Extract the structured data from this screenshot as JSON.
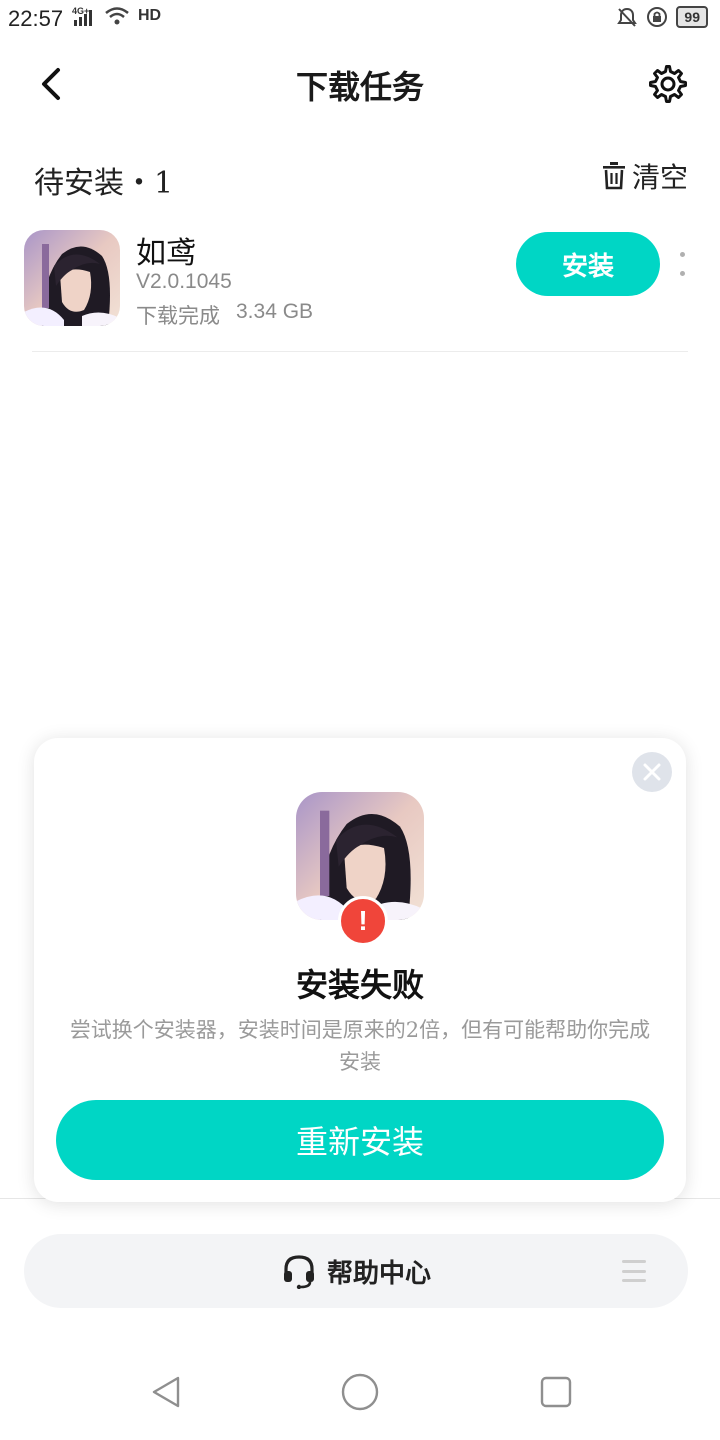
{
  "status_bar": {
    "time": "22:57",
    "network_label": "4G+",
    "hd_label": "HD",
    "battery_level": "99"
  },
  "header": {
    "title": "下载任务",
    "back_icon": "chevron-left-icon",
    "settings_icon": "gear-icon"
  },
  "section": {
    "title": "待安装・1",
    "clear_label": "清空",
    "clear_icon": "trash-icon"
  },
  "app": {
    "name": "如鸢",
    "version": "V2.0.1045",
    "status": "下载完成",
    "size": "3.34 GB",
    "install_label": "安装"
  },
  "dialog": {
    "title": "安装失败",
    "description": "尝试换个安装器，安装时间是原来的2倍，但有可能帮助你完成安装",
    "button_label": "重新安装",
    "badge_glyph": "!"
  },
  "help_bar": {
    "label": "帮助中心",
    "icon": "headset-icon"
  },
  "colors": {
    "accent": "#00d6c5",
    "error": "#f0453a",
    "secondary_text": "#8a8a8a"
  }
}
